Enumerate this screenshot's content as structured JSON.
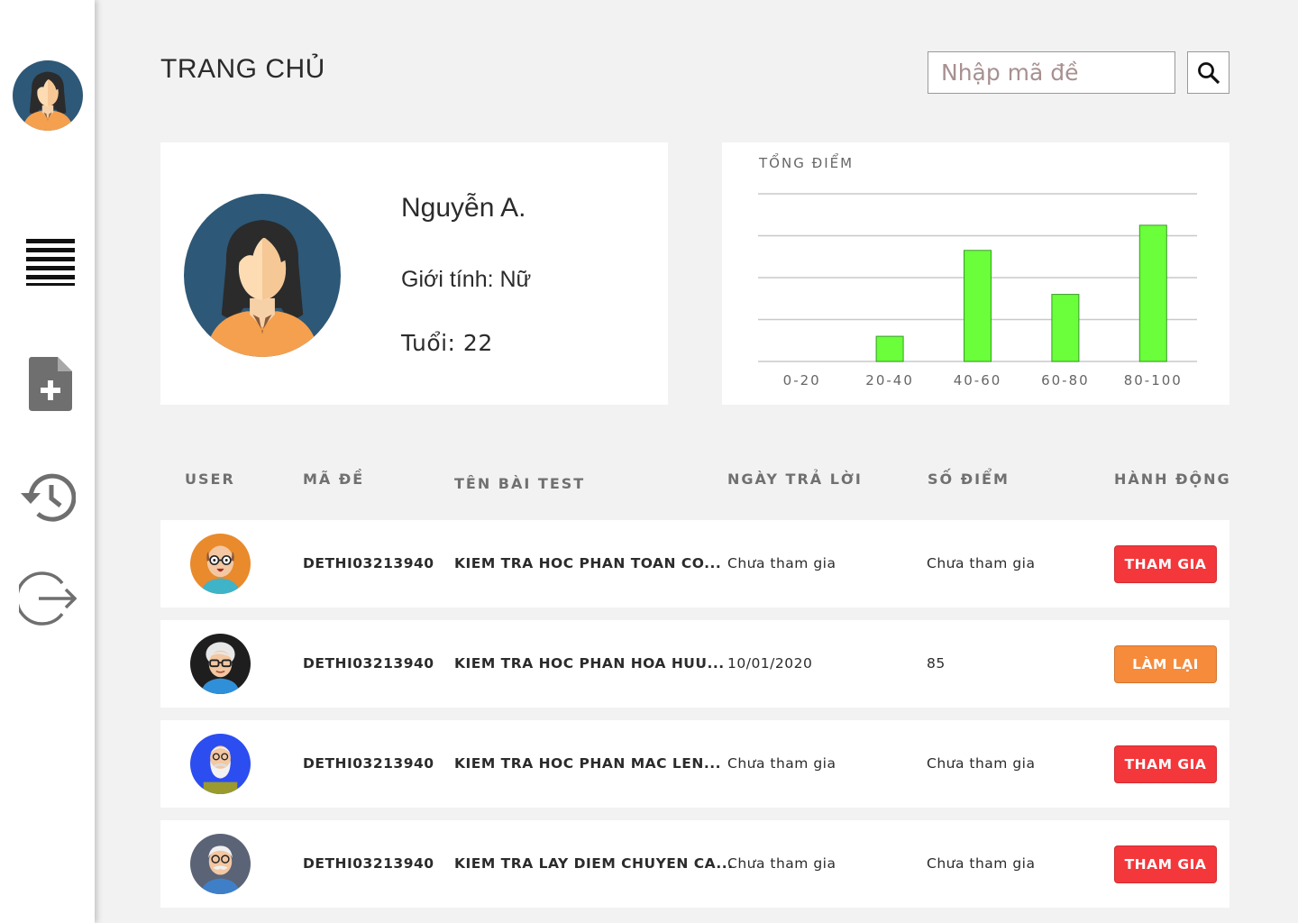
{
  "page": {
    "title": "TRANG CHỦ"
  },
  "search": {
    "placeholder": "Nhập mã đề",
    "icon": "search-icon"
  },
  "sidebar": {
    "items": [
      {
        "name": "user-avatar",
        "icon": "avatar-female"
      },
      {
        "name": "menu",
        "icon": "menu-icon"
      },
      {
        "name": "new-test",
        "icon": "document-add-icon"
      },
      {
        "name": "history",
        "icon": "history-icon"
      },
      {
        "name": "logout",
        "icon": "logout-icon"
      }
    ]
  },
  "profile": {
    "name": "Nguyễn A.",
    "gender": "Giới tính: Nữ",
    "age": "Tuổi: 22"
  },
  "chart_data": {
    "type": "bar",
    "title": "TỔNG ĐIỂM",
    "categories": [
      "0-20",
      "20-40",
      "40-60",
      "60-80",
      "80-100"
    ],
    "values": [
      0,
      0.6,
      2.65,
      1.6,
      3.25
    ],
    "ylim": [
      0,
      4
    ],
    "grid": true,
    "bar_color": "#6aff3a"
  },
  "table": {
    "headers": {
      "user": "USER",
      "code": "MÃ ĐỀ",
      "name": "TÊN BÀI TEST",
      "date": "NGÀY TRẢ LỜI",
      "score": "SỐ ĐIỂM",
      "action": "HÀNH ĐỘNG"
    },
    "rows": [
      {
        "avatar": "avatar-bald-man-glasses",
        "code": "DETHI03213940",
        "name": "KIEM TRA HOC PHAN TOAN CO...",
        "date": "Chưa tham gia",
        "score": "Chưa tham gia",
        "action": "THAM GIA",
        "action_color": "#f4373b"
      },
      {
        "avatar": "avatar-old-woman-glasses",
        "code": "DETHI03213940",
        "name": "KIEM TRA HOC PHAN HOA HUU...",
        "date": "10/01/2020",
        "score": "85",
        "action": "LÀM LẠI",
        "action_color": "#f58b3b"
      },
      {
        "avatar": "avatar-old-man-beard",
        "code": "DETHI03213940",
        "name": "KIEM TRA HOC PHAN MAC LEN...",
        "date": "Chưa tham gia",
        "score": "Chưa tham gia",
        "action": "THAM GIA",
        "action_color": "#f4373b"
      },
      {
        "avatar": "avatar-old-man-mustache",
        "code": "DETHI03213940",
        "name": "KIEM TRA LAY DIEM CHUYEN CA...",
        "date": "Chưa tham gia",
        "score": "Chưa tham gia",
        "action": "THAM GIA",
        "action_color": "#f4373b"
      }
    ]
  }
}
